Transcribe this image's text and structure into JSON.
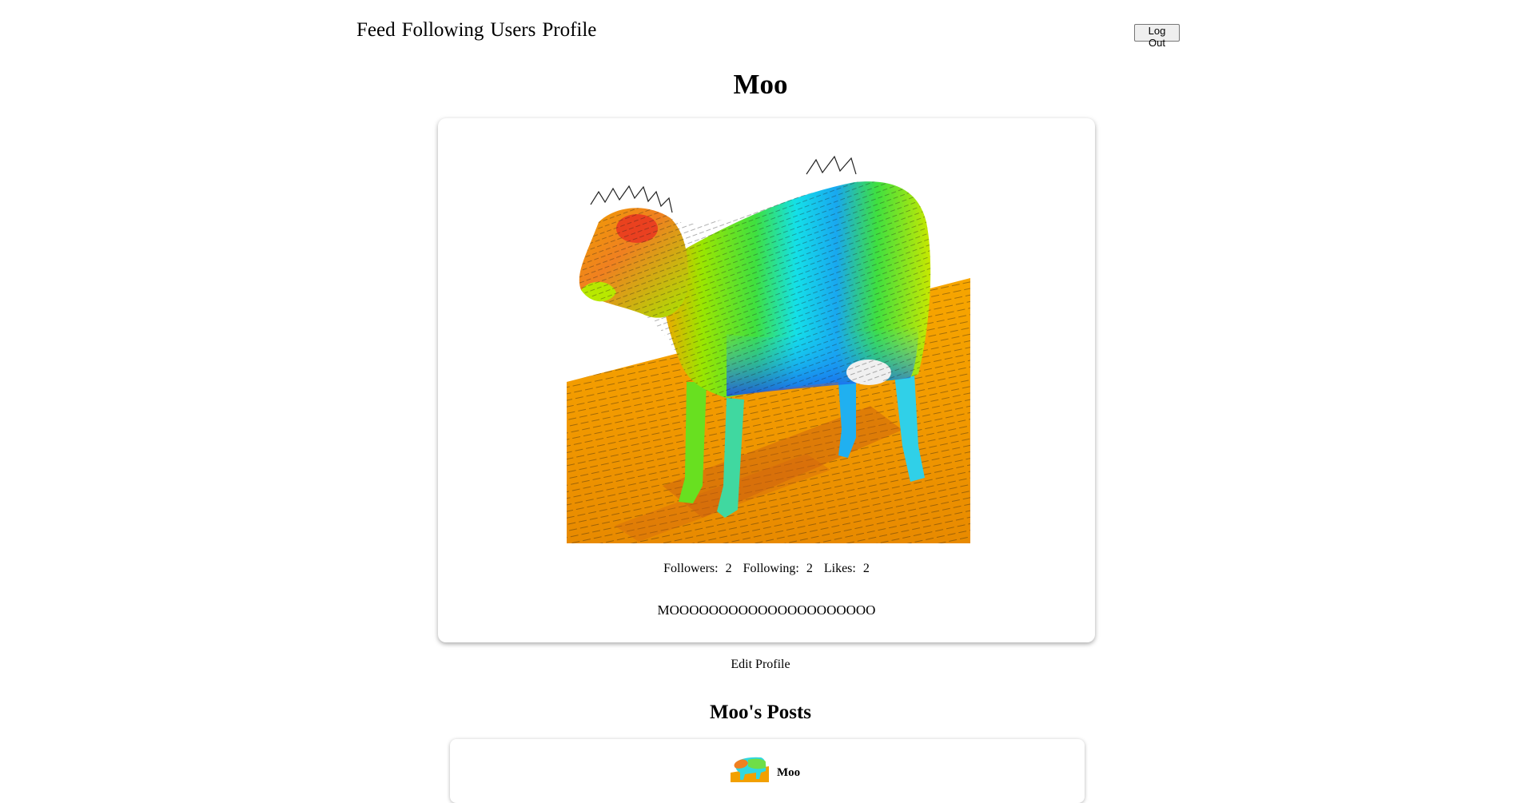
{
  "nav": {
    "links": [
      "Feed",
      "Following",
      "Users",
      "Profile"
    ],
    "logout_label": "Log Out"
  },
  "profile": {
    "name": "Moo",
    "image_icon": "cow-heatmap-image",
    "stats": {
      "followers_label": "Followers:",
      "followers": "2",
      "following_label": "Following:",
      "following": "2",
      "likes_label": "Likes:",
      "likes": "2"
    },
    "bio": "MOOOOOOOOOOOOOOOOOOOOO",
    "edit_label": "Edit Profile"
  },
  "posts": {
    "heading": "Moo's Posts",
    "items": [
      {
        "author": "Moo",
        "avatar_icon": "cow-heatmap-image"
      }
    ]
  }
}
